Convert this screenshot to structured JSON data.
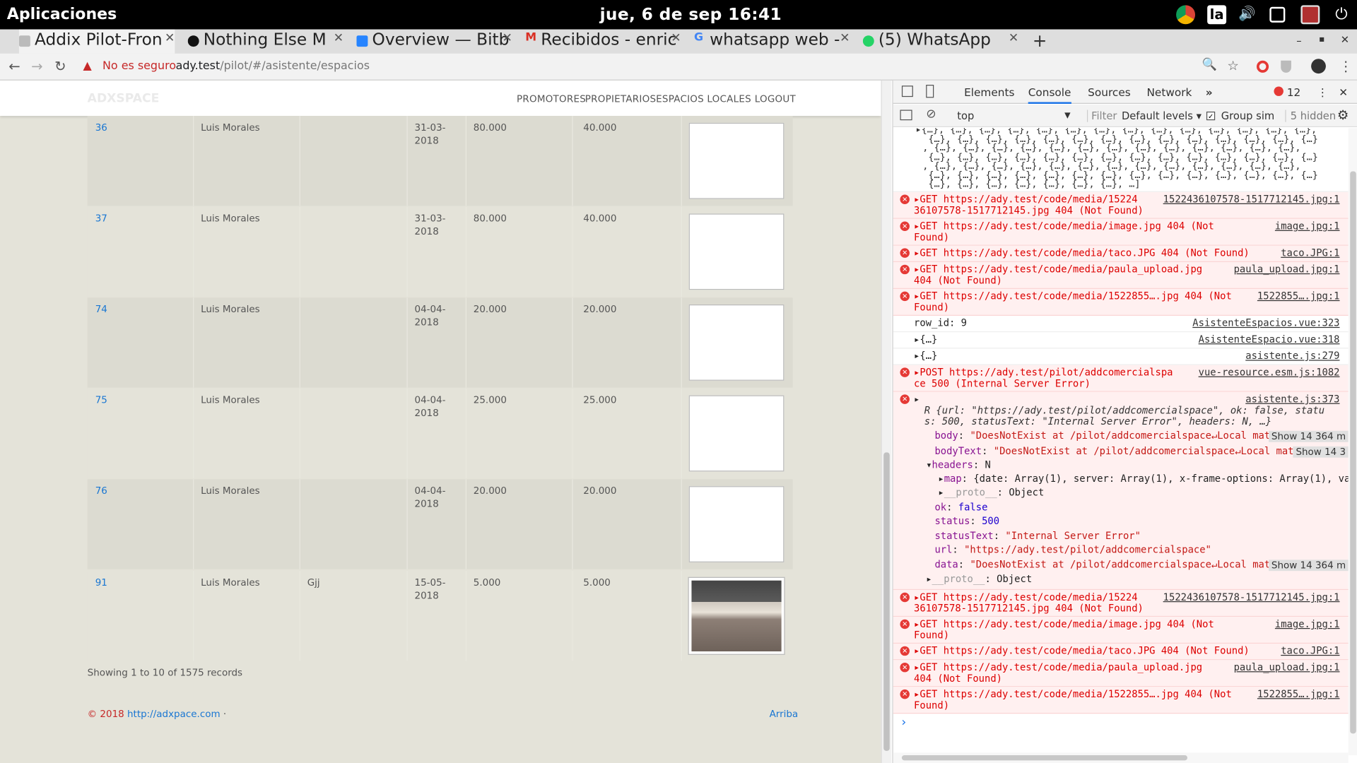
{
  "system": {
    "apps_label": "Aplicaciones",
    "clock": "jue,  6 de sep  16:41"
  },
  "tabs": [
    {
      "label": "Addix Pilot-Fron",
      "icon": "doc-icon",
      "color": "#777777"
    },
    {
      "label": "Nothing Else M",
      "icon": "spotify-icon",
      "color": "#1db954"
    },
    {
      "label": "Overview — Bitb",
      "icon": "bitbucket-icon",
      "color": "#2684ff"
    },
    {
      "label": "Recibidos - enric",
      "icon": "gmail-icon",
      "color": "#d93025"
    },
    {
      "label": "whatsapp web -",
      "icon": "google-icon",
      "color": "#4285f4"
    },
    {
      "label": "(5) WhatsApp",
      "icon": "whatsapp-icon",
      "color": "#25d366"
    }
  ],
  "addressbar": {
    "security": "No es seguro",
    "url_host": "ady.test",
    "url_path": "/pilot/#/asistente/espacios"
  },
  "site": {
    "logo": "ADXSPACE",
    "menu": [
      "PROMOTORES",
      "PROPIETARIOS",
      "ESPACIOS",
      "LOCALES",
      "LOGOUT"
    ]
  },
  "table": {
    "rows": [
      {
        "id": "36",
        "owner": "Luis Morales",
        "name": "",
        "date": "31-03-\n2018",
        "price": "80.000",
        "price2": "40.000",
        "image": "blank"
      },
      {
        "id": "37",
        "owner": "Luis Morales",
        "name": "",
        "date": "31-03-\n2018",
        "price": "80.000",
        "price2": "40.000",
        "image": "blank"
      },
      {
        "id": "74",
        "owner": "Luis Morales",
        "name": "",
        "date": "04-04-\n2018",
        "price": "20.000",
        "price2": "20.000",
        "image": "blank"
      },
      {
        "id": "75",
        "owner": "Luis Morales",
        "name": "",
        "date": "04-04-\n2018",
        "price": "25.000",
        "price2": "25.000",
        "image": "blank"
      },
      {
        "id": "76",
        "owner": "Luis Morales",
        "name": "",
        "date": "04-04-\n2018",
        "price": "20.000",
        "price2": "20.000",
        "image": "blank"
      },
      {
        "id": "91",
        "owner": "Luis Morales",
        "name": "Gjj",
        "date": "15-05-\n2018",
        "price": "5.000",
        "price2": "5.000",
        "image": "photo"
      }
    ],
    "records": "Showing 1 to 10 of 1575 records"
  },
  "footer": {
    "copyright": "© 2018 ",
    "link": "http://adxpace.com",
    "sep": " ·",
    "top_link": "Arriba"
  },
  "devtools": {
    "tabs": [
      "Elements",
      "Console",
      "Sources",
      "Network"
    ],
    "more": "»",
    "error_count": "12",
    "context": "top",
    "filter_placeholder": "Filter",
    "levels": "Default levels",
    "group_similar": "Group sim",
    "hidden": "5 hidden",
    "array_dump": [
      "▸{…}, {…}, {…}, {…}, {…}, {…}, {…}, {…}, {…}, {…}, {…}, {…}, {…}, {…},",
      " {…}, {…}, {…}, {…}, {…}, {…}, {…}, {…}, {…}, {…}, {…}, {…}, {…}, {…}",
      ", {…}, {…}, {…}, {…}, {…}, {…}, {…}, {…}, {…}, {…}, {…}, {…}, {…},",
      " {…}, {…}, {…}, {…}, {…}, {…}, {…}, {…}, {…}, {…}, {…}, {…}, {…}, {…}",
      ", {…}, {…}, {…}, {…}, {…}, {…}, {…}, {…}, {…}, {…}, {…}, {…}, {…},",
      " {…}, {…}, {…}, {…}, {…}, {…}, {…}, {…}, {…}, {…}, {…}, {…}, {…}, {…}",
      " {…}, {…}, {…}, {…}, {…}, {…}, {…}, …]"
    ],
    "messages": [
      {
        "kind": "err",
        "text": "▸GET https://ady.test/code/media/15224\n36107578-1517712145.jpg 404 (Not Found)",
        "src": "1522436107578-1517712145.jpg:1"
      },
      {
        "kind": "err",
        "text": "▸GET https://ady.test/code/media/image.jpg 404 (Not\nFound)",
        "src": "image.jpg:1"
      },
      {
        "kind": "err",
        "text": "▸GET https://ady.test/code/media/taco.JPG 404 (Not Found)",
        "src": "taco.JPG:1"
      },
      {
        "kind": "err",
        "text": "▸GET https://ady.test/code/media/paula_upload.jpg\n404 (Not Found)",
        "src": "paula_upload.jpg:1"
      },
      {
        "kind": "err",
        "text": "▸GET https://ady.test/code/media/1522855….jpg 404 (Not\nFound)",
        "src": "1522855….jpg:1"
      },
      {
        "kind": "log",
        "text": "row_id: 9",
        "src": "AsistenteEspacios.vue:323"
      },
      {
        "kind": "log",
        "text": "▸{…}",
        "src": "AsistenteEspacio.vue:318"
      },
      {
        "kind": "log",
        "text": "▸{…}",
        "src": "asistente.js:279"
      },
      {
        "kind": "err",
        "text": "▸POST https://ady.test/pilot/addcomercialspa\nce 500 (Internal Server Error)",
        "src": "vue-resource.esm.js:1082"
      }
    ],
    "response_object": {
      "src": "asistente.js:373",
      "summary": "R {url: \"https://ady.test/pilot/addcomercialspace\", ok: false, statu",
      "summary2": "s: 500, statusText: \"Internal Server Error\", headers: N, …}",
      "body": "\"DoesNotExist at /pilot/addcomercialspace↵Local mat",
      "bodyText": "\"DoesNotExist at /pilot/addcomercialspace↵Local mat",
      "show_more": "Show 14 364 m",
      "show_more_short": "Show 14 3",
      "headers": "N",
      "map": "{date: Array(1), server: Array(1), x-frame-options: Array(1), va",
      "proto": "Object",
      "ok": "false",
      "status": "500",
      "statusText": "\"Internal Server Error\"",
      "url": "\"https://ady.test/pilot/addcomercialspace\"",
      "data": "\"DoesNotExist at /pilot/addcomercialspace↵Local mat"
    },
    "messages_after": [
      {
        "kind": "err",
        "text": "▸GET https://ady.test/code/media/15224\n36107578-1517712145.jpg 404 (Not Found)",
        "src": "1522436107578-1517712145.jpg:1"
      },
      {
        "kind": "err",
        "text": "▸GET https://ady.test/code/media/image.jpg 404 (Not\nFound)",
        "src": "image.jpg:1"
      },
      {
        "kind": "err",
        "text": "▸GET https://ady.test/code/media/taco.JPG 404 (Not Found)",
        "src": "taco.JPG:1"
      },
      {
        "kind": "err",
        "text": "▸GET https://ady.test/code/media/paula_upload.jpg\n404 (Not Found)",
        "src": "paula_upload.jpg:1"
      },
      {
        "kind": "err",
        "text": "▸GET https://ady.test/code/media/1522855….jpg 404 (Not\nFound)",
        "src": "1522855….jpg:1"
      }
    ],
    "prompt": "›"
  }
}
